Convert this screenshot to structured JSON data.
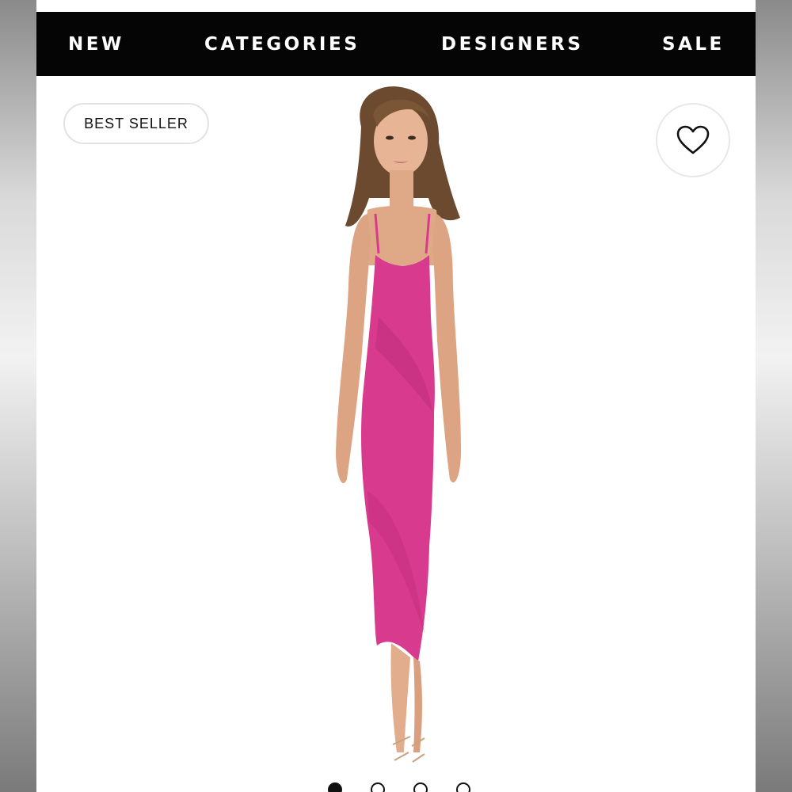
{
  "nav": {
    "items": [
      {
        "label": "NEW"
      },
      {
        "label": "CATEGORIES"
      },
      {
        "label": "DESIGNERS"
      },
      {
        "label": "SALE"
      }
    ]
  },
  "product": {
    "badge": "BEST SELLER",
    "favorite_icon": "heart-icon",
    "image_description_icon": "product-photo",
    "dress_color": "#d83a8e"
  },
  "carousel": {
    "total_slides": 4,
    "active_slide": 1
  },
  "colors": {
    "nav_background": "#050505",
    "nav_text": "#ffffff"
  }
}
